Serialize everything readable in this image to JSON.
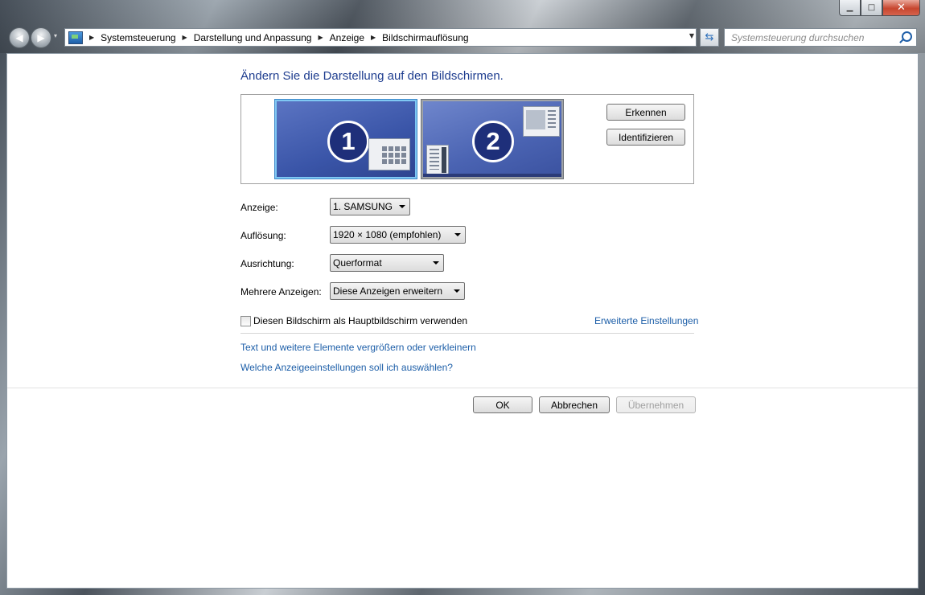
{
  "window": {
    "caption_minimize": "▁",
    "caption_maximize": "□",
    "caption_close": "✕"
  },
  "navbar": {
    "back_glyph": "◀",
    "forward_glyph": "▶",
    "history_glyph": "▾",
    "breadcrumbs": [
      "Systemsteuerung",
      "Darstellung und Anpassung",
      "Anzeige",
      "Bildschirmauflösung"
    ],
    "breadcrumb_separator": "▶",
    "address_dropdown_glyph": "▼",
    "refresh_glyph": "⇆",
    "search_placeholder": "Systemsteuerung durchsuchen"
  },
  "main": {
    "heading": "Ändern Sie die Darstellung auf den Bildschirmen.",
    "monitors": [
      {
        "number": "1",
        "selected": true
      },
      {
        "number": "2",
        "selected": false
      }
    ],
    "detect_button": "Erkennen",
    "identify_button": "Identifizieren",
    "fields": {
      "display_label": "Anzeige:",
      "display_value": "1. SAMSUNG",
      "resolution_label": "Auflösung:",
      "resolution_value": "1920 × 1080 (empfohlen)",
      "orientation_label": "Ausrichtung:",
      "orientation_value": "Querformat",
      "multiple_label": "Mehrere Anzeigen:",
      "multiple_value": "Diese Anzeigen erweitern"
    },
    "primary_checkbox_label": "Diesen Bildschirm als Hauptbildschirm verwenden",
    "primary_checked": false,
    "advanced_link": "Erweiterte Einstellungen",
    "text_size_link": "Text und weitere Elemente vergrößern oder verkleinern",
    "help_link": "Welche Anzeigeeinstellungen soll ich auswählen?",
    "ok_button": "OK",
    "cancel_button": "Abbrechen",
    "apply_button": "Übernehmen"
  },
  "colors": {
    "heading": "#1e3d8f",
    "link": "#1c5ea8",
    "monitor_selected_border": "#7fc7f3",
    "monitor_fill": "#3a55a8"
  }
}
